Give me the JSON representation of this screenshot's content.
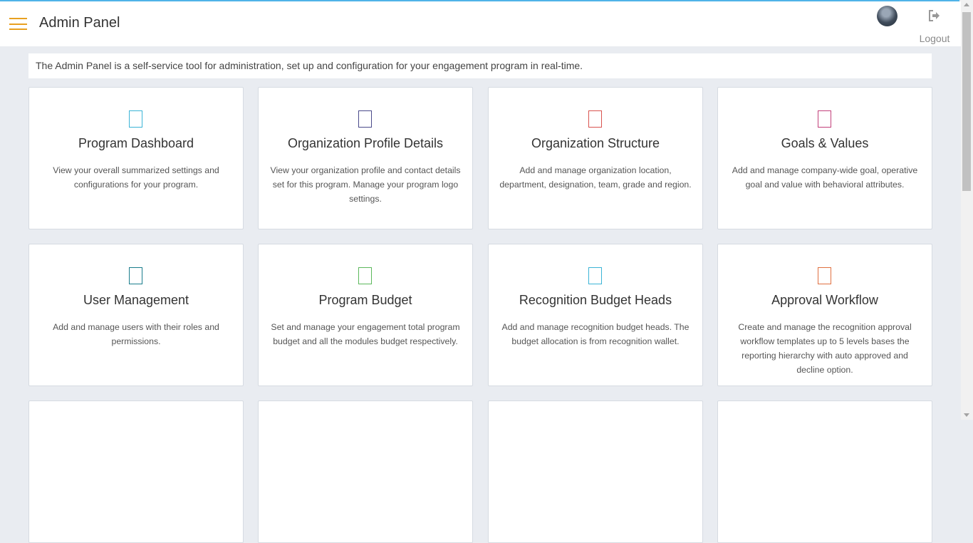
{
  "header": {
    "title": "Admin Panel",
    "logout_label": "Logout"
  },
  "intro": "The Admin Panel is a self-service tool for administration, set up and configuration for your engagement program in real-time.",
  "cards": [
    {
      "title": "Program Dashboard",
      "desc": "View your overall summarized settings and configurations for your program.",
      "icon": "dashboard-icon",
      "color": "#3bb4d6"
    },
    {
      "title": "Organization Profile Details",
      "desc": "View your organization profile and contact details set for this program. Manage your program logo settings.",
      "icon": "profile-icon",
      "color": "#4a4a8a"
    },
    {
      "title": "Organization Structure",
      "desc": "Add and manage organization location, department, designation, team, grade and region.",
      "icon": "structure-icon",
      "color": "#d9534f"
    },
    {
      "title": "Goals & Values",
      "desc": "Add and manage company-wide goal, operative goal and value with behavioral attributes.",
      "icon": "goals-icon",
      "color": "#c2407a"
    },
    {
      "title": "User Management",
      "desc": "Add and manage users with their roles and permissions.",
      "icon": "users-icon",
      "color": "#1a7d8c"
    },
    {
      "title": "Program Budget",
      "desc": "Set and manage your engagement total program budget and all the modules budget respectively.",
      "icon": "budget-icon",
      "color": "#5cb85c"
    },
    {
      "title": "Recognition Budget Heads",
      "desc": "Add and manage recognition budget heads. The budget allocation is from recognition wallet.",
      "icon": "recognition-icon",
      "color": "#3bb4d6"
    },
    {
      "title": "Approval Workflow",
      "desc": "Create and manage the recognition approval workflow templates up to 5 levels bases the reporting hierarchy with auto approved and decline option.",
      "icon": "workflow-icon",
      "color": "#e07040"
    },
    {
      "title": "",
      "desc": "",
      "icon": "",
      "color": "#999999"
    },
    {
      "title": "",
      "desc": "",
      "icon": "",
      "color": "#999999"
    },
    {
      "title": "",
      "desc": "",
      "icon": "",
      "color": "#999999"
    },
    {
      "title": "",
      "desc": "",
      "icon": "",
      "color": "#999999"
    }
  ]
}
